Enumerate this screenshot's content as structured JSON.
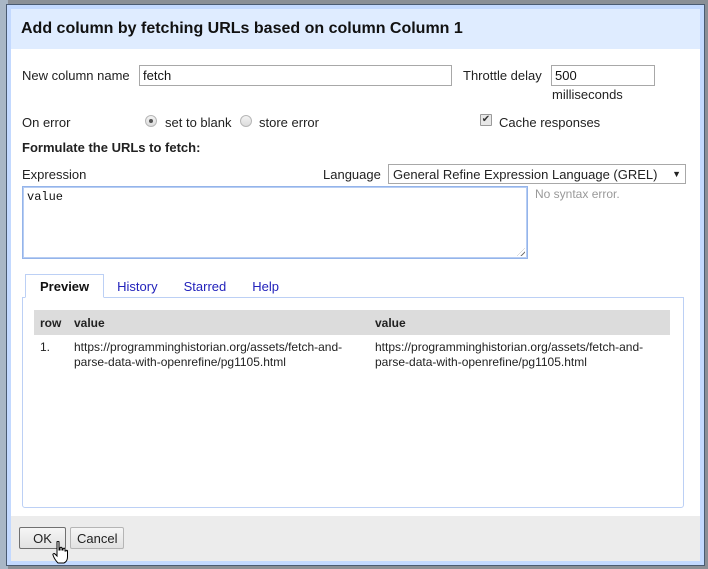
{
  "dialog": {
    "title": "Add column by fetching URLs based on column Column 1"
  },
  "form": {
    "new_column_label": "New column name",
    "new_column_value": "fetch",
    "throttle_label": "Throttle delay",
    "throttle_value": "500",
    "throttle_unit": "milliseconds",
    "on_error_label": "On error",
    "on_error_options": [
      {
        "label": "set to blank",
        "checked": true
      },
      {
        "label": "store error",
        "checked": false
      }
    ],
    "cache_label": "Cache responses",
    "cache_checked": true,
    "formulate_heading": "Formulate the URLs to fetch:",
    "expression_label": "Expression",
    "language_label": "Language",
    "language_selected": "General Refine Expression Language (GREL)",
    "expression_value": "value",
    "syntax_status": "No syntax error."
  },
  "tabs": [
    {
      "label": "Preview",
      "active": true
    },
    {
      "label": "History",
      "active": false
    },
    {
      "label": "Starred",
      "active": false
    },
    {
      "label": "Help",
      "active": false
    }
  ],
  "preview": {
    "headers": [
      "row",
      "value",
      "value"
    ],
    "rows": [
      {
        "row": "1.",
        "input": "https://programminghistorian.org/assets/fetch-and-parse-data-with-openrefine/pg1105.html",
        "output": "https://programminghistorian.org/assets/fetch-and-parse-data-with-openrefine/pg1105.html"
      }
    ]
  },
  "footer": {
    "ok_label": "OK",
    "cancel_label": "Cancel"
  },
  "icons": {
    "checkmark": "✔",
    "dropdown_arrow": "▼"
  }
}
